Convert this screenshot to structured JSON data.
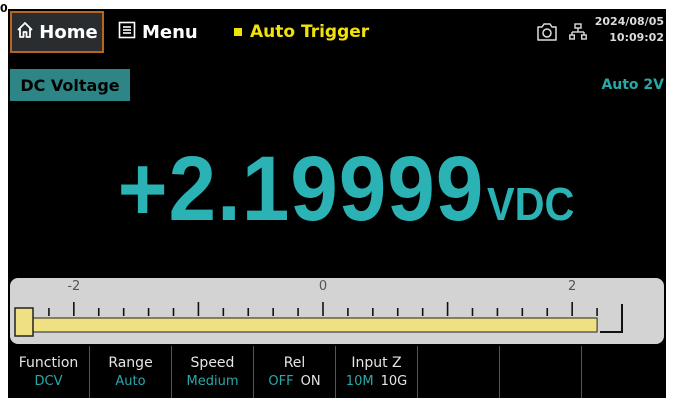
{
  "corner_mark": "0",
  "header": {
    "home_label": "Home",
    "menu_label": "Menu",
    "trigger_label": "Auto Trigger",
    "date": "2024/08/05",
    "time": "10:09:02"
  },
  "measurement": {
    "function_tag": "DC Voltage",
    "range_tag": "Auto 2V",
    "value": "+2.19999",
    "unit": "VDC"
  },
  "bargraph": {
    "scale_labels": [
      "-2",
      "0",
      "2"
    ],
    "min": -2.4,
    "max": 2.4,
    "reading": 2.19999,
    "bar_color": "#efe083"
  },
  "softkeys": [
    {
      "label": "Function",
      "value": "DCV"
    },
    {
      "label": "Range",
      "value": "Auto"
    },
    {
      "label": "Speed",
      "value": "Medium"
    },
    {
      "label": "Rel",
      "options": [
        "OFF",
        "ON"
      ],
      "active": "OFF"
    },
    {
      "label": "Input Z",
      "options": [
        "10M",
        "10G"
      ],
      "active": "10M"
    },
    {
      "label": ""
    },
    {
      "label": ""
    },
    {
      "label": ""
    }
  ],
  "colors": {
    "accent_teal": "#2bb2b4",
    "trigger_yellow": "#f2e20b",
    "home_border": "#b8651e"
  }
}
